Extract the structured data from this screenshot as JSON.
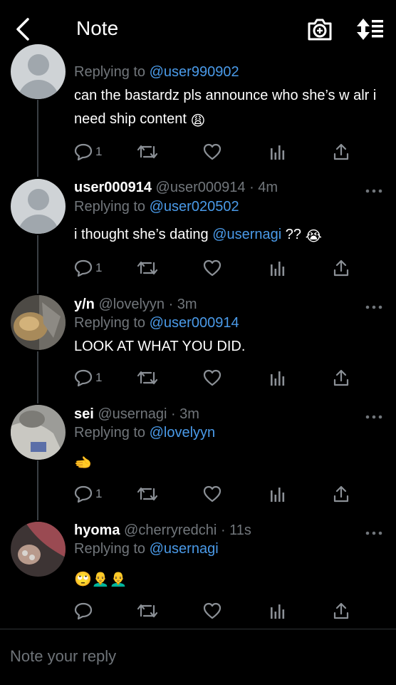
{
  "header": {
    "title": "Note"
  },
  "tweets": [
    {
      "name": "",
      "handle": "",
      "time": "",
      "replying_label": "Replying to",
      "replying_to": "@user990902",
      "text": "can the bastardz pls announce who she’s w alr i need ship content",
      "emoji": "😩",
      "reply_count": "1"
    },
    {
      "name": "user000914",
      "handle": "@user000914",
      "time": "· 4m",
      "replying_label": "Replying to",
      "replying_to": "@user020502",
      "text_before": "i thought she’s dating ",
      "mention": "@usernagi",
      "text_after": " ?? ",
      "emoji": "😭",
      "reply_count": "1"
    },
    {
      "name": "y/n",
      "handle": "@lovelyyn",
      "time": "· 3m",
      "replying_label": "Replying to",
      "replying_to": "@user000914",
      "text": "LOOK AT WHAT YOU DID.",
      "reply_count": "1"
    },
    {
      "name": "sei",
      "handle": "@usernagi",
      "time": "· 3m",
      "replying_label": "Replying to",
      "replying_to": "@lovelyyn",
      "emoji": "🫲",
      "reply_count": "1"
    },
    {
      "name": "hyoma",
      "handle": "@cherryredchi",
      "time": "· 11s",
      "replying_label": "Replying to",
      "replying_to": "@usernagi",
      "emoji": "🙄👨‍🦲👨‍🦲",
      "reply_count": ""
    }
  ],
  "reply_box": {
    "placeholder": "Note your reply"
  },
  "icons": {
    "back": "chevron-left-icon",
    "camera": "camera-plus-icon",
    "sort": "sort-icon",
    "reply": "speech-bubble-icon",
    "retweet": "retweet-icon",
    "like": "heart-icon",
    "views": "bar-chart-icon",
    "share": "share-icon",
    "more": "more-dots-icon"
  },
  "colors": {
    "link": "#4a9ae8",
    "muted": "#71767b",
    "background": "#000000"
  }
}
